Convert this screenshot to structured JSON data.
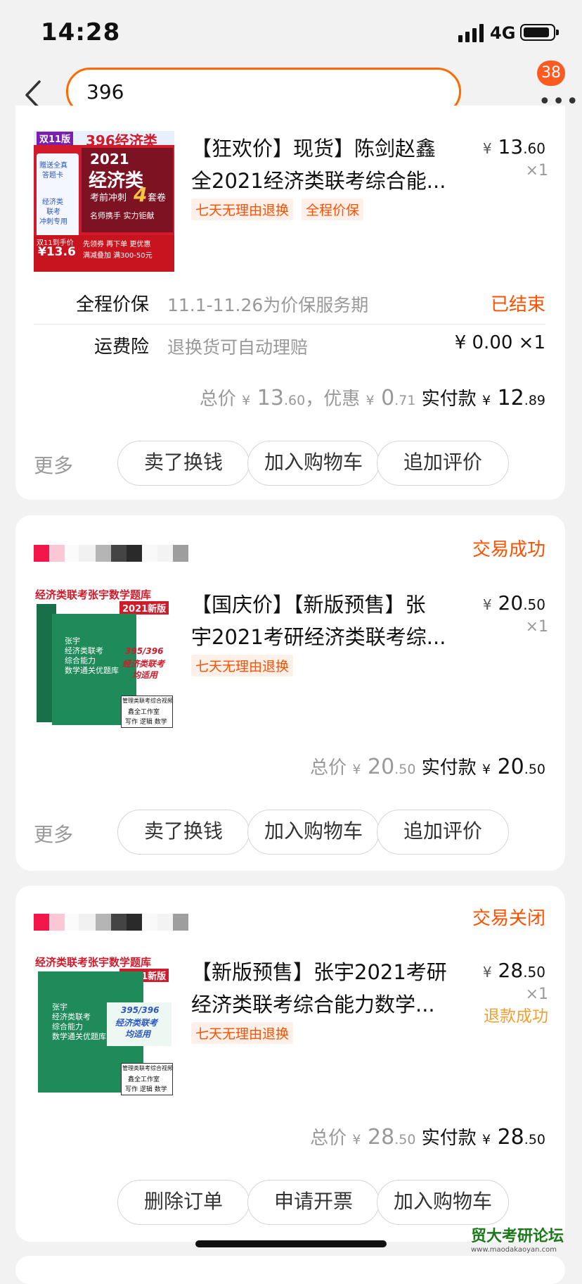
{
  "status_bar": {
    "time": "14:28",
    "network": "4G"
  },
  "nav": {
    "search_value": "396",
    "badge_count": "38"
  },
  "orders": [
    {
      "title_line1": "【狂欢价】现货】陈剑赵鑫",
      "title_line2": "全2021经济类联考综合能...",
      "tags": [
        "七天无理由退换",
        "全程价保"
      ],
      "price_yen": "¥",
      "price_int": " 13",
      "price_dec": ".60",
      "qty": "×1",
      "thumb": {
        "top_badge": "双11版",
        "header": "396经济类",
        "year_title": "2021",
        "main_title": "经济类",
        "subtitle": "考前冲刺",
        "num": "4",
        "suffix": "套卷",
        "slogan": "名师携手 实力钜献",
        "side_1": "赠送全真",
        "side_2": "答题卡",
        "side_3": "经济类",
        "side_4": "联考",
        "side_5": "冲刺专用",
        "sale_label": "双11到手价",
        "sale_price": "¥13.6",
        "promo_1": "先领券 再下单 更优惠",
        "promo_2": "满减叠加 满300-50元"
      },
      "service_rows": [
        {
          "label": "全程价保",
          "desc": "11.1-11.26为价保服务期",
          "right": "已结束"
        },
        {
          "label": "运费险",
          "desc": "退换货可自动理赔",
          "right": "¥ 0.00 ×1"
        }
      ],
      "total_label": "总价",
      "total_yen": "¥",
      "total_int": " 13",
      "total_dec": ".60",
      "discount_label": "，优惠",
      "discount_yen": "¥",
      "discount_int": " 0",
      "discount_dec": ".71",
      "paid_label": "实付款",
      "paid_yen": "¥",
      "paid_int": " 12",
      "paid_dec": ".89",
      "more": "更多",
      "buttons": [
        "卖了换钱",
        "加入购物车",
        "追加评价"
      ]
    },
    {
      "status": "交易成功",
      "title_line1": "【国庆价】【新版预售】张",
      "title_line2": "宇2021考研经济类联考综...",
      "tags": [
        "七天无理由退换"
      ],
      "price_yen": "¥",
      "price_int": " 20",
      "price_dec": ".50",
      "qty": "×1",
      "thumb": {
        "header": "经济类联考张宇数学题库",
        "edition": "2021新版",
        "cover_1": "张宇",
        "cover_2": "经济类联考",
        "cover_3": "综合能力",
        "cover_4": "数学通关优题库",
        "stamp": "395/396",
        "stamp_2": "经济类联考",
        "stamp_3": "均适用",
        "footer_1": "管理类联考综合视频",
        "footer_2": "鑫全工作室",
        "footer_3": "写作 逻辑 数学"
      },
      "total_label": "总价",
      "total_yen": "¥",
      "total_int": " 20",
      "total_dec": ".50",
      "paid_label": "实付款",
      "paid_yen": "¥",
      "paid_int": " 20",
      "paid_dec": ".50",
      "more": "更多",
      "buttons": [
        "卖了换钱",
        "加入购物车",
        "追加评价"
      ]
    },
    {
      "status": "交易关闭",
      "title_line1": "【新版预售】张宇2021考研",
      "title_line2": "经济类联考综合能力数学...",
      "tags": [
        "七天无理由退换"
      ],
      "price_yen": "¥",
      "price_int": " 28",
      "price_dec": ".50",
      "qty": "×1",
      "refund": "退款成功",
      "thumb": {
        "header": "经济类联考张宇数学题库",
        "edition": "2021新版",
        "cover_1": "张宇",
        "cover_2": "经济类联考",
        "cover_3": "综合能力",
        "cover_4": "数学通关优题库",
        "stamp": "395/396",
        "stamp_2": "经济类联考",
        "stamp_3": "均适用",
        "footer_1": "管理类联考综合视频",
        "footer_2": "鑫全工作室",
        "footer_3": "写作 逻辑 数学"
      },
      "total_label": "总价",
      "total_yen": "¥",
      "total_int": " 28",
      "total_dec": ".50",
      "paid_label": "实付款",
      "paid_yen": "¥",
      "paid_int": " 28",
      "paid_dec": ".50",
      "buttons": [
        "删除订单",
        "申请开票",
        "加入购物车"
      ]
    }
  ],
  "watermark": {
    "text": "贸大考研论坛",
    "url": "www.maodakaoyan.com"
  },
  "colors": {
    "accent": "#ff5000",
    "search_border": "#ff6a00",
    "refund": "#f0a030",
    "book_green": "#1f8a5a"
  }
}
